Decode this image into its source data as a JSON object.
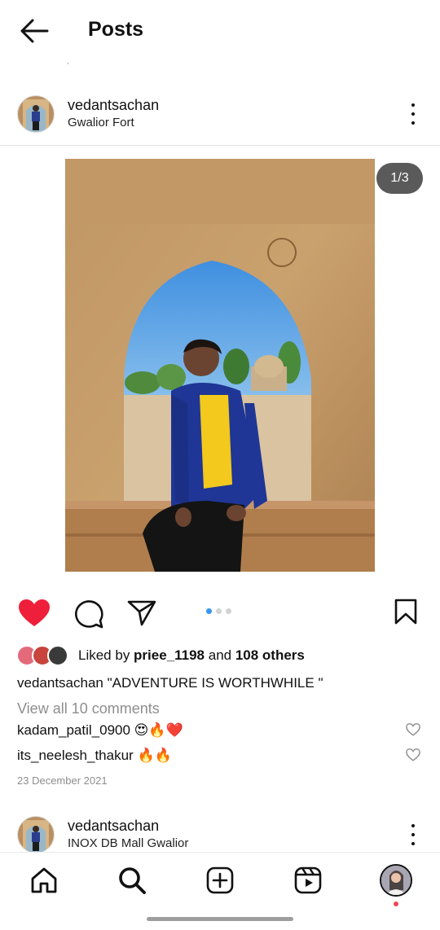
{
  "header": {
    "title": "Posts"
  },
  "post": {
    "username": "vedantsachan",
    "location": "Gwalior Fort",
    "counter": "1/3",
    "liked_prefix": "Liked by ",
    "liked_user": "priee_1198",
    "liked_and": " and ",
    "liked_others": "108 others",
    "caption_user": "vedantsachan",
    "caption_text": " \"ADVENTURE IS WORTHWHILE \"",
    "view_comments": "View all 10 comments",
    "comments": [
      {
        "user": "kadam_patil_0900",
        "text": " 😍🔥❤️"
      },
      {
        "user": "its_neelesh_thakur",
        "text": " 🔥🔥"
      }
    ],
    "date": "23 December 2021",
    "liked": true,
    "carousel_active_index": 0,
    "carousel_count": 3
  },
  "next_post": {
    "username": "vedantsachan",
    "location": "INOX DB Mall Gwalior"
  },
  "nav": {
    "items": [
      "home-icon",
      "search-icon",
      "create-icon",
      "reels-icon",
      "profile-avatar"
    ]
  },
  "colors": {
    "like": "#ed1f3a",
    "notification_dot": "#ed4956",
    "muted": "#8e8e8e"
  }
}
